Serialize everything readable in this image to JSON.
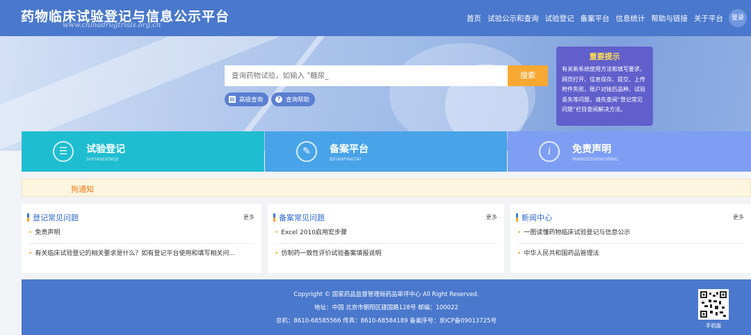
{
  "header": {
    "title": "药物临床试验登记与信息公示平台",
    "subtitle": "www.chinadrugtrials.org.cn",
    "nav": [
      "首页",
      "试验公示和查询",
      "试验登记",
      "备案平台",
      "信息统计",
      "帮助与链接",
      "关于平台"
    ],
    "login_label": "登录"
  },
  "search": {
    "placeholder": "查询药物试验，如输入 \"糖尿_",
    "button_label": "搜索",
    "advanced_label": "高级查询",
    "help_label": "查询帮助"
  },
  "notice": {
    "title": "重要提示",
    "text": "有关新系统使用方法和填写要求，网页打开、信息保存、提交、上传附件失败，账户对接后品种、试验丢失等问题，请先查阅“登记常见问题”栏目查阅解决方法。"
  },
  "tiles": [
    {
      "title": "试验登记",
      "subtitle": "SHIYANDENGJI"
    },
    {
      "title": "备案平台",
      "subtitle": "BEIANPINGTAI"
    },
    {
      "title": "免责声明",
      "subtitle": "MIANZESHENGMING"
    }
  ],
  "strip": {
    "text": "狗通知"
  },
  "columns": [
    {
      "title": "登记常见问题",
      "more": "更多",
      "items": [
        "免责声明",
        "有关临床试验登记的相关要求是什么？如有登记平台使用和填写相关问..."
      ]
    },
    {
      "title": "备案常见问题",
      "more": "更多",
      "items": [
        "Excel 2010启用宏步骤",
        "仿制药一致性评价试验备案填报说明"
      ]
    },
    {
      "title": "新闻中心",
      "more": "更多",
      "items": [
        "一图读懂药物临床试验登记与信息公示",
        "中华人民共和国药品管理法"
      ]
    }
  ],
  "footer": {
    "copyright": "Copyright © 国家药品监督管理局药品审评中心 All Right Reserved.",
    "address": "地址：中国 北京市朝阳区建国路128号 邮编：100022",
    "contact": "总机：8610-68585566 传真：8610-68584189 备案序号：京ICP备09013725号",
    "qr_label": "手机版"
  },
  "colors": {
    "header_blue": "#4a78cc",
    "search_orange": "#f6a832",
    "tile_teal": "#1fbdd0",
    "tile_blue": "#48a3e8",
    "tile_violet": "#7e9ef3",
    "notice_orange": "#ef7a1a"
  }
}
